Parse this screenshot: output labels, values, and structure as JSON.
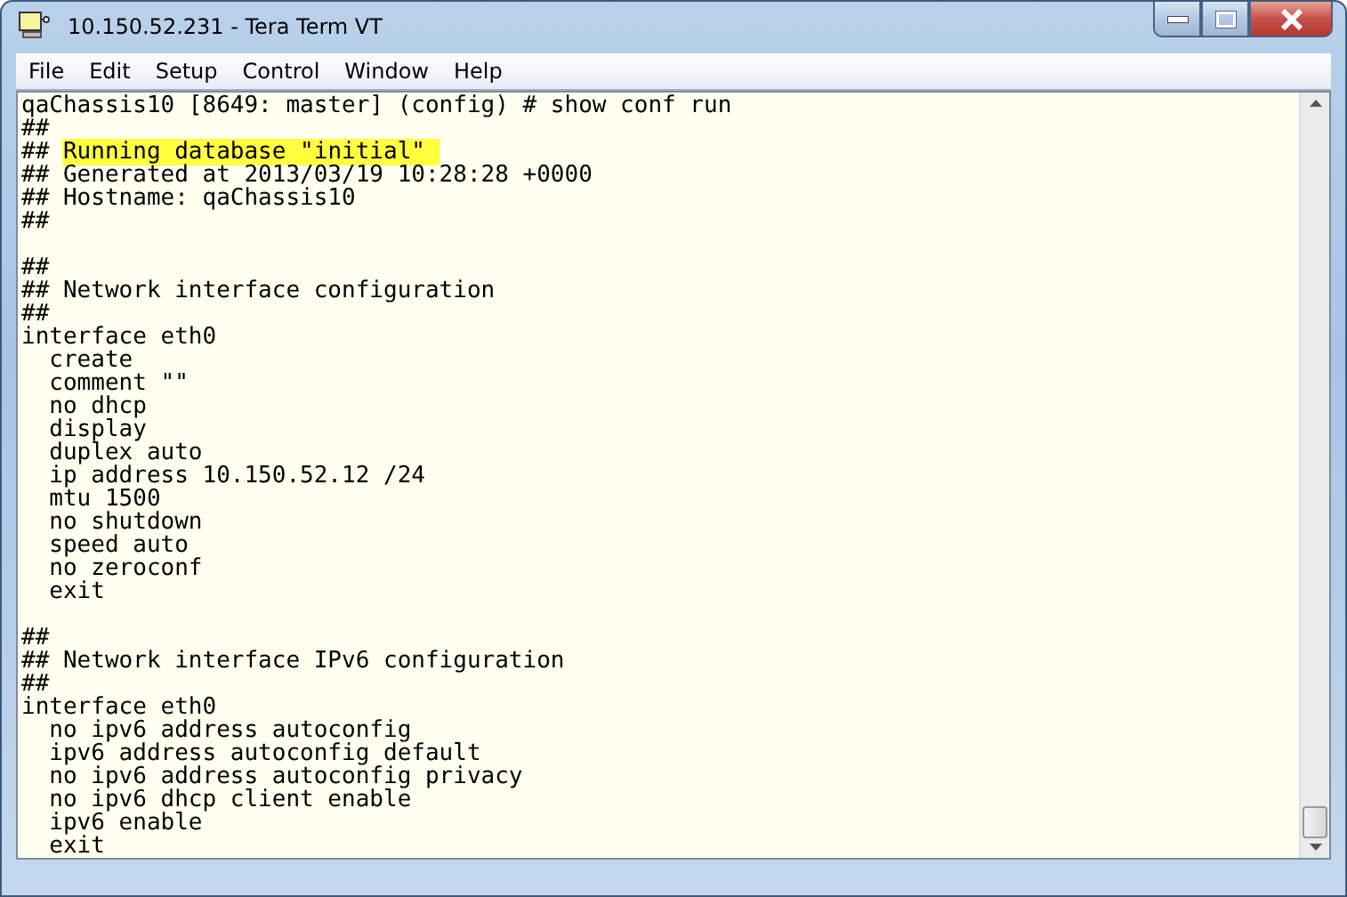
{
  "window": {
    "title": "10.150.52.231 - Tera Term VT"
  },
  "menu": [
    "File",
    "Edit",
    "Setup",
    "Control",
    "Window",
    "Help"
  ],
  "terminal": {
    "lines": [
      {
        "kind": "text",
        "text": "qaChassis10 [8649: master] (config) # show conf run"
      },
      {
        "kind": "text",
        "text": "##"
      },
      {
        "kind": "text",
        "text": "## ",
        "highlight": "Running database \"initial\" "
      },
      {
        "kind": "text",
        "text": "## Generated at 2013/03/19 10:28:28 +0000"
      },
      {
        "kind": "text",
        "text": "## Hostname: qaChassis10"
      },
      {
        "kind": "text",
        "text": "##"
      },
      {
        "kind": "blank"
      },
      {
        "kind": "text",
        "text": "##"
      },
      {
        "kind": "text",
        "text": "## Network interface configuration"
      },
      {
        "kind": "text",
        "text": "##"
      },
      {
        "kind": "text",
        "text": "interface eth0"
      },
      {
        "kind": "text",
        "text": "  create"
      },
      {
        "kind": "text",
        "text": "  comment \"\""
      },
      {
        "kind": "text",
        "text": "  no dhcp"
      },
      {
        "kind": "text",
        "text": "  display"
      },
      {
        "kind": "text",
        "text": "  duplex auto"
      },
      {
        "kind": "text",
        "text": "  ip address 10.150.52.12 /24"
      },
      {
        "kind": "text",
        "text": "  mtu 1500"
      },
      {
        "kind": "text",
        "text": "  no shutdown"
      },
      {
        "kind": "text",
        "text": "  speed auto"
      },
      {
        "kind": "text",
        "text": "  no zeroconf"
      },
      {
        "kind": "text",
        "text": "  exit"
      },
      {
        "kind": "blank"
      },
      {
        "kind": "text",
        "text": "##"
      },
      {
        "kind": "text",
        "text": "## Network interface IPv6 configuration"
      },
      {
        "kind": "text",
        "text": "##"
      },
      {
        "kind": "text",
        "text": "interface eth0"
      },
      {
        "kind": "text",
        "text": "  no ipv6 address autoconfig"
      },
      {
        "kind": "text",
        "text": "  ipv6 address autoconfig default"
      },
      {
        "kind": "text",
        "text": "  no ipv6 address autoconfig privacy"
      },
      {
        "kind": "text",
        "text": "  no ipv6 dhcp client enable"
      },
      {
        "kind": "text",
        "text": "  ipv6 enable"
      },
      {
        "kind": "text",
        "text": "  exit"
      }
    ]
  }
}
